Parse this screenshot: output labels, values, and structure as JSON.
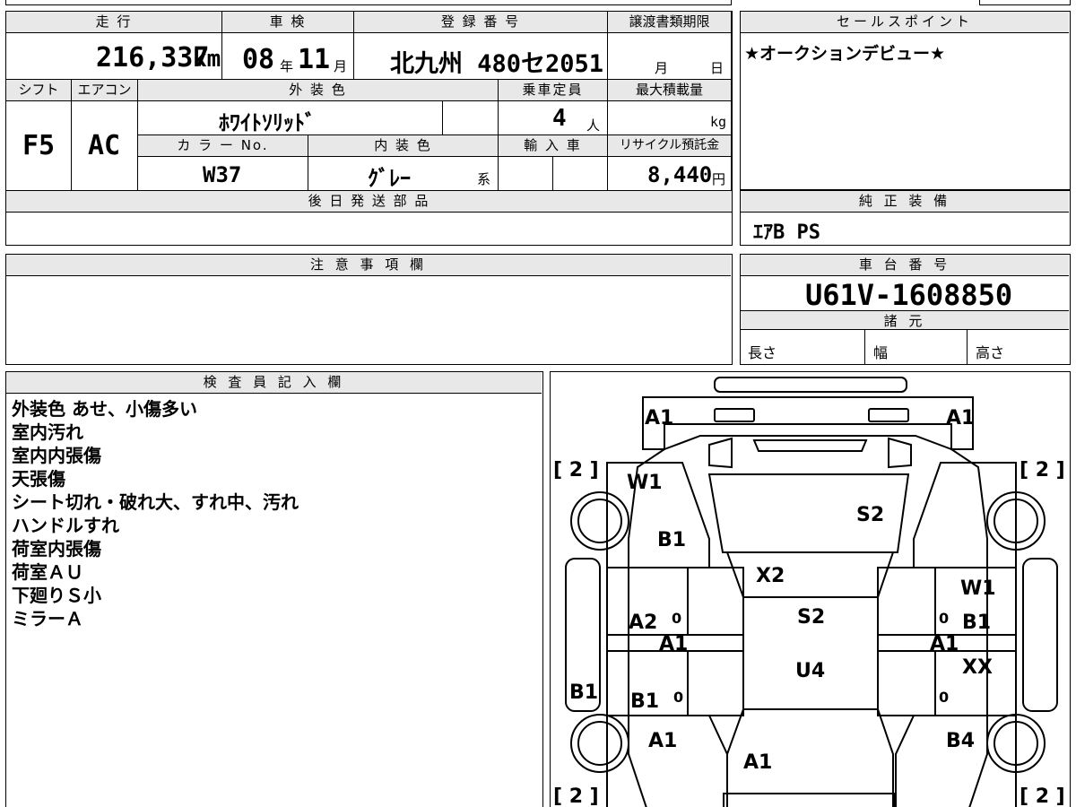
{
  "top": {
    "mileage_label": "走 行",
    "mileage_value": "216,337",
    "mileage_unit": "km",
    "shaken_label": "車 検",
    "shaken_year": "08",
    "shaken_year_unit": "年",
    "shaken_month": "11",
    "shaken_month_unit": "月",
    "reg_label": "登 録 番 号",
    "reg_value": "北九州 480セ2051",
    "transfer_label": "譲渡書類期限",
    "transfer_month": "月",
    "transfer_day": "日",
    "sales_label": "セールスポイント",
    "sales_value": "★オークションデビュー★"
  },
  "mid": {
    "shift_label": "シフト",
    "shift_value": "F5",
    "ac_label": "エアコン",
    "ac_value": "AC",
    "exterior_label": "外 装 色",
    "exterior_value": "ﾎﾜｲﾄｿﾘｯﾄﾞ",
    "capacity_label": "乗車定員",
    "capacity_value": "4",
    "capacity_unit": "人",
    "maxload_label": "最大積載量",
    "maxload_unit": "kg",
    "color_no_label": "カ ラ ー No.",
    "color_no_value": "W37",
    "interior_label": "内 装 色",
    "interior_value": "ｸﾞﾚｰ",
    "interior_unit": "系",
    "import_label": "輸 入 車",
    "recycle_label": "リサイクル預託金",
    "recycle_value": "8,440",
    "recycle_unit": "円"
  },
  "later_parts_label": "後 日 発 送 部 品",
  "genuine_label": "純 正 装 備",
  "genuine_value": "ｴｱB PS",
  "caution_label": "注 意 事 項 欄",
  "chassis_label": "車 台 番 号",
  "chassis_value": "U61V-1608850",
  "spec_label": "諸 元",
  "spec": {
    "length": "長さ",
    "width": "幅",
    "height": "高さ"
  },
  "inspector_label": "検 査 員 記 入 欄",
  "inspector_notes": [
    "外装色 あせ、小傷多い",
    "室内汚れ",
    "室内内張傷",
    "天張傷",
    "シート切れ・破れ大、すれ中、汚れ",
    "ハンドルすれ",
    "荷室内張傷",
    "荷室ＡＵ",
    "下廻りＳ小",
    "ミラーＡ"
  ],
  "diagram": {
    "marks": {
      "front_left": "A1",
      "front_right": "A1",
      "tire_fl": "[ 2 ]",
      "tire_fr": "[ 2 ]",
      "tire_rl": "[ 2 ]",
      "tire_rr": "[ 2 ]",
      "fender_left": "W1",
      "fender_left_lower": "B1",
      "hood": "S2",
      "windshield": "X2",
      "roof": "S2",
      "roof_rear": "U4",
      "door_fl": "A2",
      "door_fl_zero": "0",
      "door_sill_left": "A1",
      "door_rl": "B1",
      "door_rl_zero": "0",
      "rocker_left": "B1",
      "quarter_left": "A1",
      "rear_gate": "A1",
      "door_fr_top": "W1",
      "door_fr": "B1",
      "door_fr_zero": "0",
      "door_sill_right": "A1",
      "door_rr": "XX",
      "door_rr_zero": "0",
      "quarter_right": "B4"
    }
  }
}
